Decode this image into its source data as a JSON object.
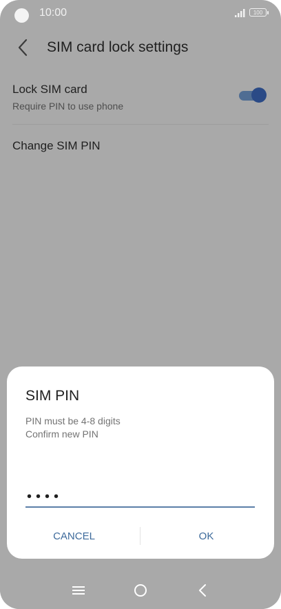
{
  "status_bar": {
    "time": "10:00",
    "battery": "100"
  },
  "header": {
    "title": "SIM card lock settings"
  },
  "settings": {
    "lock": {
      "title": "Lock SIM card",
      "subtitle": "Require PIN to use phone",
      "enabled": true
    },
    "change_pin": {
      "title": "Change SIM PIN"
    }
  },
  "dialog": {
    "title": "SIM PIN",
    "message_line1": "PIN must be 4-8 digits",
    "message_line2": "Confirm new PIN",
    "pin_value": "••••",
    "cancel_label": "CANCEL",
    "ok_label": "OK"
  },
  "colors": {
    "accent": "#3d6a9b",
    "toggle_on": "#2a4a86",
    "scrim": "#a9a9a9"
  },
  "icons": [
    "back-arrow-icon",
    "recent-apps-icon",
    "home-icon",
    "nav-back-icon",
    "signal-icon",
    "battery-icon"
  ]
}
